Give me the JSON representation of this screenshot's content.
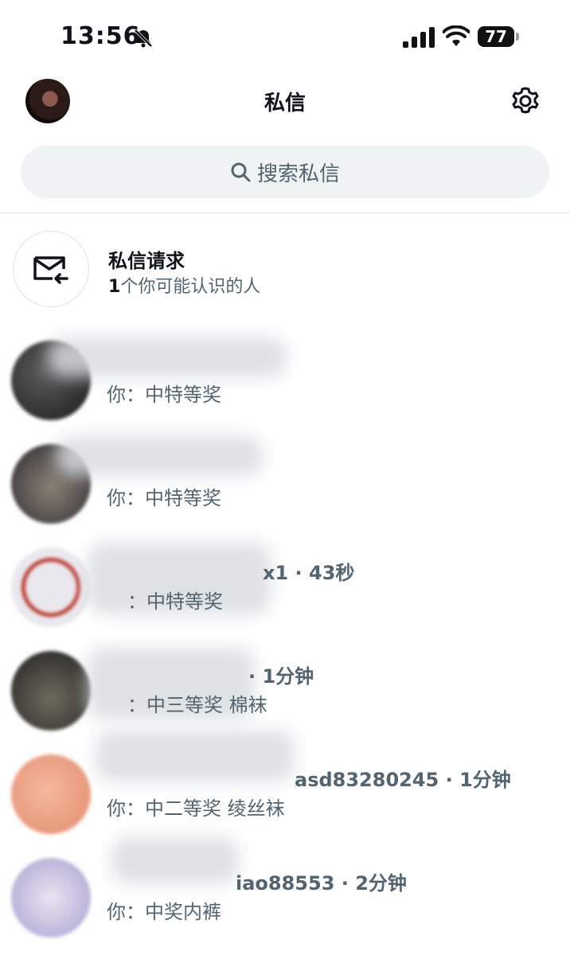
{
  "status": {
    "time": "13:56",
    "battery": "77"
  },
  "header": {
    "title": "私信"
  },
  "search": {
    "placeholder": "搜索私信"
  },
  "requests": {
    "title": "私信请求",
    "count": "1",
    "subtitle": "个你可能认识的人"
  },
  "conversations": [
    {
      "name_line": "",
      "preview": "你：中特等奖",
      "avatar_colors": [
        "#5a5a5a",
        "#1c1c1c"
      ]
    },
    {
      "name_line": "",
      "preview": "你：中特等奖",
      "avatar_colors": [
        "#8a7f73",
        "#2c2a30"
      ]
    },
    {
      "name_line": "x1 · 43秒",
      "preview": "：中特等奖",
      "avatar_colors": [
        "#e8e8ee",
        "#4a90d9"
      ]
    },
    {
      "name_line": "· 1分钟",
      "preview": "：中三等奖 棉袜",
      "avatar_colors": [
        "#6f6a5d",
        "#202020"
      ]
    },
    {
      "name_line": "asd83280245 · 1分钟",
      "preview": "你：中二等奖 绫丝袜",
      "avatar_colors": [
        "#f4b89c",
        "#e48c6e"
      ]
    },
    {
      "name_line": "iao88553 · 2分钟",
      "preview": "你：中奖内裤",
      "avatar_colors": [
        "#e9e4f1",
        "#a8a0d0"
      ]
    }
  ]
}
